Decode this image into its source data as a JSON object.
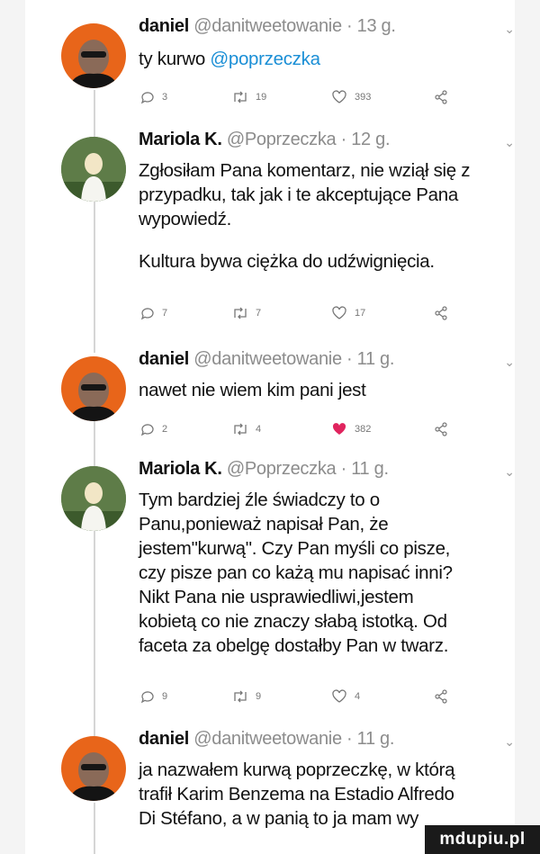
{
  "tweets": [
    {
      "name": "daniel",
      "meta": "@danitweetowanie · 13 g.",
      "mention": "@poprzeczka",
      "text": "ty kurwo",
      "replies": "3",
      "retweets": "19",
      "likes": "393",
      "liked": false
    },
    {
      "name": "Mariola K.",
      "meta": "@Poprzeczka · 12 g.",
      "lines": [
        "Zgłosiłam Pana komentarz, nie wziął się z",
        "przypadku, tak jak i te akceptujące Pana",
        "wypowiedź."
      ],
      "lines2": [
        "Kultura bywa ciężka do udźwignięcia."
      ],
      "replies": "7",
      "retweets": "7",
      "likes": "17",
      "liked": false
    },
    {
      "name": "daniel",
      "meta": "@danitweetowanie · 11 g.",
      "lines": [
        "nawet nie wiem kim pani jest"
      ],
      "replies": "2",
      "retweets": "4",
      "likes": "382",
      "liked": true
    },
    {
      "name": "Mariola K.",
      "meta": "@Poprzeczka · 11 g.",
      "lines": [
        "Tym bardziej źle świadczy to o",
        "Panu,ponieważ napisał Pan, że",
        "jestem\"kurwą\". Czy Pan myśli co pisze,",
        "czy pisze pan co każą mu napisać inni?",
        "Nikt Pana nie usprawiedliwi,jestem",
        "kobietą co nie znaczy słabą istotką. Od",
        "faceta za obelgę dostałby Pan w twarz."
      ],
      "replies": "9",
      "retweets": "9",
      "likes": "4",
      "liked": false
    },
    {
      "name": "daniel",
      "meta": "@danitweetowanie · 11 g.",
      "lines": [
        "ja nazwałem kurwą poprzeczkę, w którą",
        "trafił Karim Benzema na Estadio Alfredo",
        "Di Stéfano, a w panią to ja mam wy"
      ]
    }
  ],
  "watermark": "mdupiu.pl",
  "colors": {
    "like_active": "#e0245e",
    "mention": "#1b8fd6",
    "daniel_bg": "#e8651a"
  }
}
